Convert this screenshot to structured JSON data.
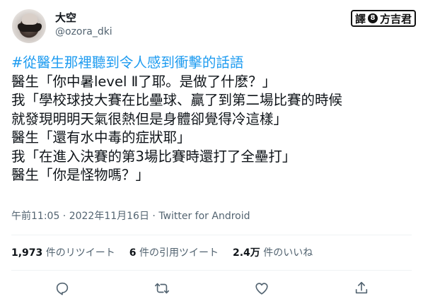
{
  "author": {
    "display_name": "大空",
    "handle": "@ozora_dki"
  },
  "watermark": {
    "left_text": "譯",
    "dot_text": "8",
    "right_text": "方吉君"
  },
  "tweet": {
    "hashtag": "#從醫生那裡聽到令人感到衝擊的話語",
    "lines": [
      "醫生「你中暑level Ⅱ了耶。是做了什麽？」",
      "我「學校球技大賽在比壘球、贏了到第二場比賽的時候",
      "就發現明明天氣很熱但是身體卻覺得冷這樣」",
      "醫生「還有水中毒的症狀耶」",
      "我「在進入決賽的第3場比賽時還打了全壘打」",
      "醫生「你是怪物嗎？」"
    ],
    "timestamp": "午前11:05 · 2022年11月16日 · ",
    "client": "Twitter for Android"
  },
  "stats": {
    "retweets_count": "1,973",
    "retweets_label": " 件のリツイート",
    "quotes_count": "6",
    "quotes_label": " 件の引用ツイート",
    "likes_count": "2.4万",
    "likes_label": " 件のいいね"
  },
  "actions": [
    {
      "name": "reply-icon"
    },
    {
      "name": "retweet-icon"
    },
    {
      "name": "like-icon"
    },
    {
      "name": "share-icon"
    }
  ],
  "colors": {
    "hashtag": "#1d9bf0",
    "secondary_text": "#536471",
    "primary_text": "#0f1419"
  }
}
